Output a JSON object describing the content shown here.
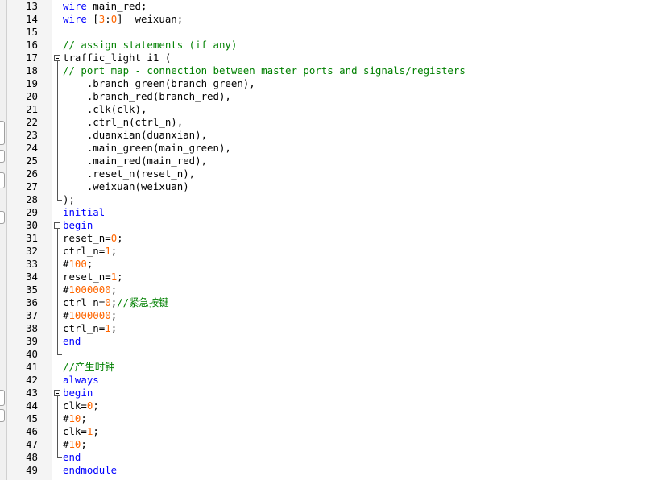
{
  "editor": {
    "lines": [
      {
        "n": "13",
        "tokens": [
          {
            "t": "wire",
            "c": "kw"
          },
          {
            "t": " main_red;",
            "c": "tx"
          }
        ]
      },
      {
        "n": "14",
        "tokens": [
          {
            "t": "wire",
            "c": "kw"
          },
          {
            "t": " [",
            "c": "tx"
          },
          {
            "t": "3",
            "c": "num"
          },
          {
            "t": ":",
            "c": "tx"
          },
          {
            "t": "0",
            "c": "num"
          },
          {
            "t": "]  weixuan;",
            "c": "tx"
          }
        ]
      },
      {
        "n": "15",
        "tokens": []
      },
      {
        "n": "16",
        "tokens": [
          {
            "t": "// assign statements (if any)",
            "c": "cm"
          }
        ]
      },
      {
        "n": "17",
        "tokens": [
          {
            "t": "traffic_light i1 (",
            "c": "tx"
          }
        ]
      },
      {
        "n": "18",
        "tokens": [
          {
            "t": "// port map - connection between master ports and signals/registers",
            "c": "cm"
          }
        ]
      },
      {
        "n": "19",
        "tokens": [
          {
            "t": "    .branch_green(branch_green),",
            "c": "tx"
          }
        ]
      },
      {
        "n": "20",
        "tokens": [
          {
            "t": "    .branch_red(branch_red),",
            "c": "tx"
          }
        ]
      },
      {
        "n": "21",
        "tokens": [
          {
            "t": "    .clk(clk),",
            "c": "tx"
          }
        ]
      },
      {
        "n": "22",
        "tokens": [
          {
            "t": "    .ctrl_n(ctrl_n),",
            "c": "tx"
          }
        ]
      },
      {
        "n": "23",
        "tokens": [
          {
            "t": "    .duanxian(duanxian),",
            "c": "tx"
          }
        ]
      },
      {
        "n": "24",
        "tokens": [
          {
            "t": "    .main_green(main_green),",
            "c": "tx"
          }
        ]
      },
      {
        "n": "25",
        "tokens": [
          {
            "t": "    .main_red(main_red),",
            "c": "tx"
          }
        ]
      },
      {
        "n": "26",
        "tokens": [
          {
            "t": "    .reset_n(reset_n),",
            "c": "tx"
          }
        ]
      },
      {
        "n": "27",
        "tokens": [
          {
            "t": "    .weixuan(weixuan)",
            "c": "tx"
          }
        ]
      },
      {
        "n": "28",
        "tokens": [
          {
            "t": ");",
            "c": "tx"
          }
        ]
      },
      {
        "n": "29",
        "tokens": [
          {
            "t": "initial",
            "c": "kw"
          }
        ]
      },
      {
        "n": "30",
        "tokens": [
          {
            "t": "begin",
            "c": "kw"
          }
        ]
      },
      {
        "n": "31",
        "tokens": [
          {
            "t": "reset_n=",
            "c": "tx"
          },
          {
            "t": "0",
            "c": "num"
          },
          {
            "t": ";",
            "c": "tx"
          }
        ]
      },
      {
        "n": "32",
        "tokens": [
          {
            "t": "ctrl_n=",
            "c": "tx"
          },
          {
            "t": "1",
            "c": "num"
          },
          {
            "t": ";",
            "c": "tx"
          }
        ]
      },
      {
        "n": "33",
        "tokens": [
          {
            "t": "#",
            "c": "tx"
          },
          {
            "t": "100",
            "c": "num"
          },
          {
            "t": ";",
            "c": "tx"
          }
        ]
      },
      {
        "n": "34",
        "tokens": [
          {
            "t": "reset_n=",
            "c": "tx"
          },
          {
            "t": "1",
            "c": "num"
          },
          {
            "t": ";",
            "c": "tx"
          }
        ]
      },
      {
        "n": "35",
        "tokens": [
          {
            "t": "#",
            "c": "tx"
          },
          {
            "t": "1000000",
            "c": "num"
          },
          {
            "t": ";",
            "c": "tx"
          }
        ]
      },
      {
        "n": "36",
        "tokens": [
          {
            "t": "ctrl_n=",
            "c": "tx"
          },
          {
            "t": "0",
            "c": "num"
          },
          {
            "t": ";",
            "c": "tx"
          },
          {
            "t": "//紧急按键",
            "c": "cm"
          }
        ]
      },
      {
        "n": "37",
        "tokens": [
          {
            "t": "#",
            "c": "tx"
          },
          {
            "t": "1000000",
            "c": "num"
          },
          {
            "t": ";",
            "c": "tx"
          }
        ]
      },
      {
        "n": "38",
        "tokens": [
          {
            "t": "ctrl_n=",
            "c": "tx"
          },
          {
            "t": "1",
            "c": "num"
          },
          {
            "t": ";",
            "c": "tx"
          }
        ]
      },
      {
        "n": "39",
        "tokens": [
          {
            "t": "end",
            "c": "kw"
          }
        ]
      },
      {
        "n": "40",
        "tokens": []
      },
      {
        "n": "41",
        "tokens": [
          {
            "t": "//产生时钟",
            "c": "cm"
          }
        ]
      },
      {
        "n": "42",
        "tokens": [
          {
            "t": "always",
            "c": "kw"
          }
        ]
      },
      {
        "n": "43",
        "tokens": [
          {
            "t": "begin",
            "c": "kw"
          }
        ]
      },
      {
        "n": "44",
        "tokens": [
          {
            "t": "clk=",
            "c": "tx"
          },
          {
            "t": "0",
            "c": "num"
          },
          {
            "t": ";",
            "c": "tx"
          }
        ]
      },
      {
        "n": "45",
        "tokens": [
          {
            "t": "#",
            "c": "tx"
          },
          {
            "t": "10",
            "c": "num"
          },
          {
            "t": ";",
            "c": "tx"
          }
        ]
      },
      {
        "n": "46",
        "tokens": [
          {
            "t": "clk=",
            "c": "tx"
          },
          {
            "t": "1",
            "c": "num"
          },
          {
            "t": ";",
            "c": "tx"
          }
        ]
      },
      {
        "n": "47",
        "tokens": [
          {
            "t": "#",
            "c": "tx"
          },
          {
            "t": "10",
            "c": "num"
          },
          {
            "t": ";",
            "c": "tx"
          }
        ]
      },
      {
        "n": "48",
        "tokens": [
          {
            "t": "end",
            "c": "kw"
          }
        ]
      },
      {
        "n": "49",
        "tokens": [
          {
            "t": "endmodule",
            "c": "kw"
          }
        ]
      }
    ],
    "colors": {
      "keyword": "#0000ff",
      "number": "#ff6600",
      "comment": "#008000",
      "text": "#000000",
      "gutter_bg": "#f4f4f4"
    },
    "folds": [
      {
        "start": "17",
        "end": "28"
      },
      {
        "start": "30",
        "end": "40"
      },
      {
        "start": "43",
        "end": "48"
      }
    ]
  }
}
